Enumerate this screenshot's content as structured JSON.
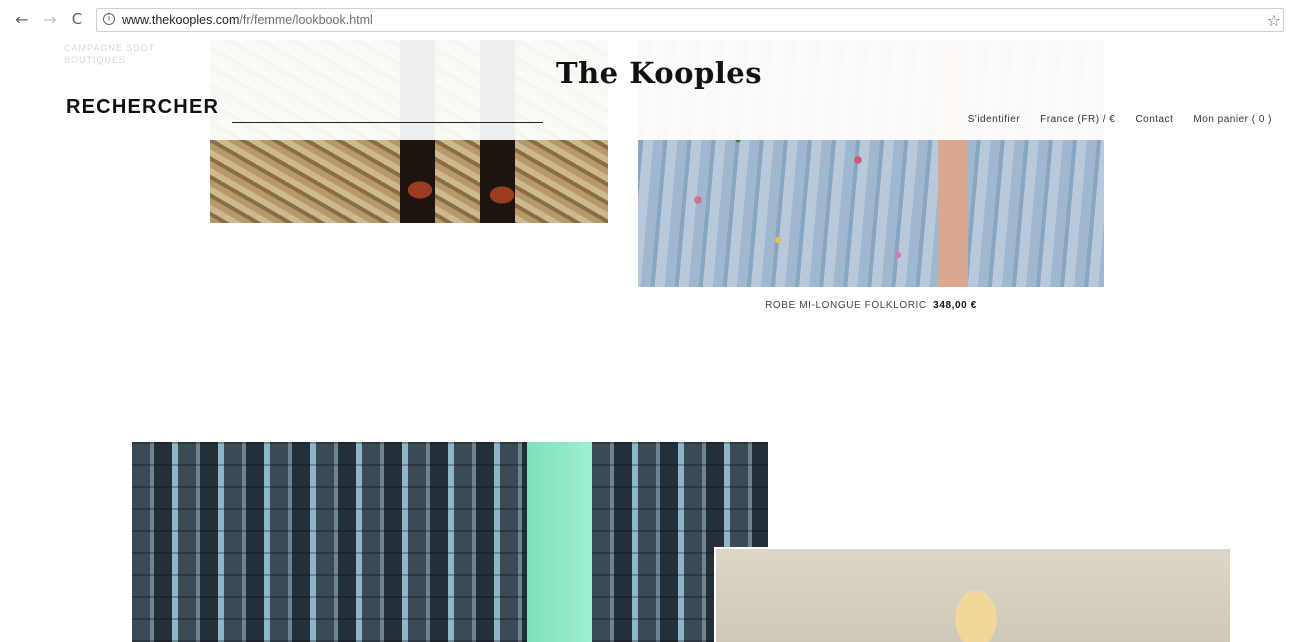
{
  "browser": {
    "url_domain": "www.thekooples.com",
    "url_path": "/fr/femme/lookbook.html",
    "icons": [
      "back-arrow-icon",
      "forward-arrow-icon",
      "reload-icon",
      "info-icon",
      "star-icon"
    ]
  },
  "header": {
    "logo": "The Kooples",
    "ghost_menu": [
      "CAMPAGNE SDOT",
      "BOUTIQUES"
    ],
    "search_label": "RECHERCHER",
    "nav": {
      "login": "S'identifier",
      "locale": "France (FR) / €",
      "contact": "Contact",
      "cart": "Mon panier ( 0 )"
    }
  },
  "products": [
    {
      "name": "ROBE MI-LONGUE FOLKLORIC",
      "price": "348,00 €"
    }
  ]
}
